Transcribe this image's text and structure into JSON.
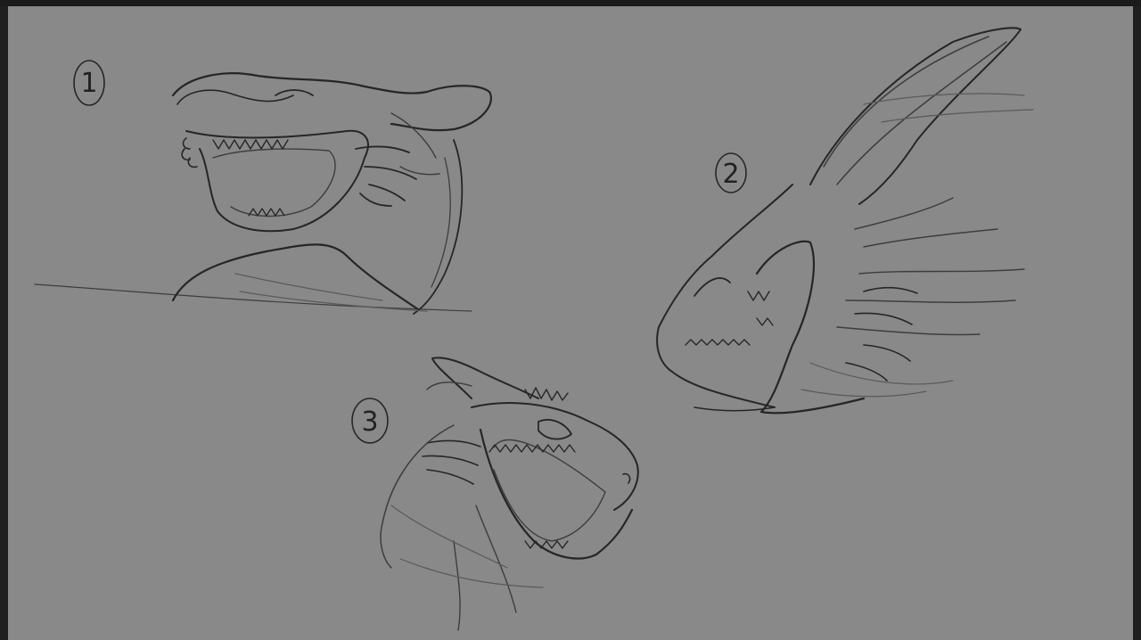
{
  "window": {
    "app": "drawing-canvas"
  },
  "canvas": {
    "background_color": "#898989",
    "stroke_color": "#262626"
  },
  "sketches": [
    {
      "number": "1",
      "subject": "creature-head-sketch-1"
    },
    {
      "number": "2",
      "subject": "creature-head-sketch-2"
    },
    {
      "number": "3",
      "subject": "creature-head-sketch-3"
    }
  ]
}
